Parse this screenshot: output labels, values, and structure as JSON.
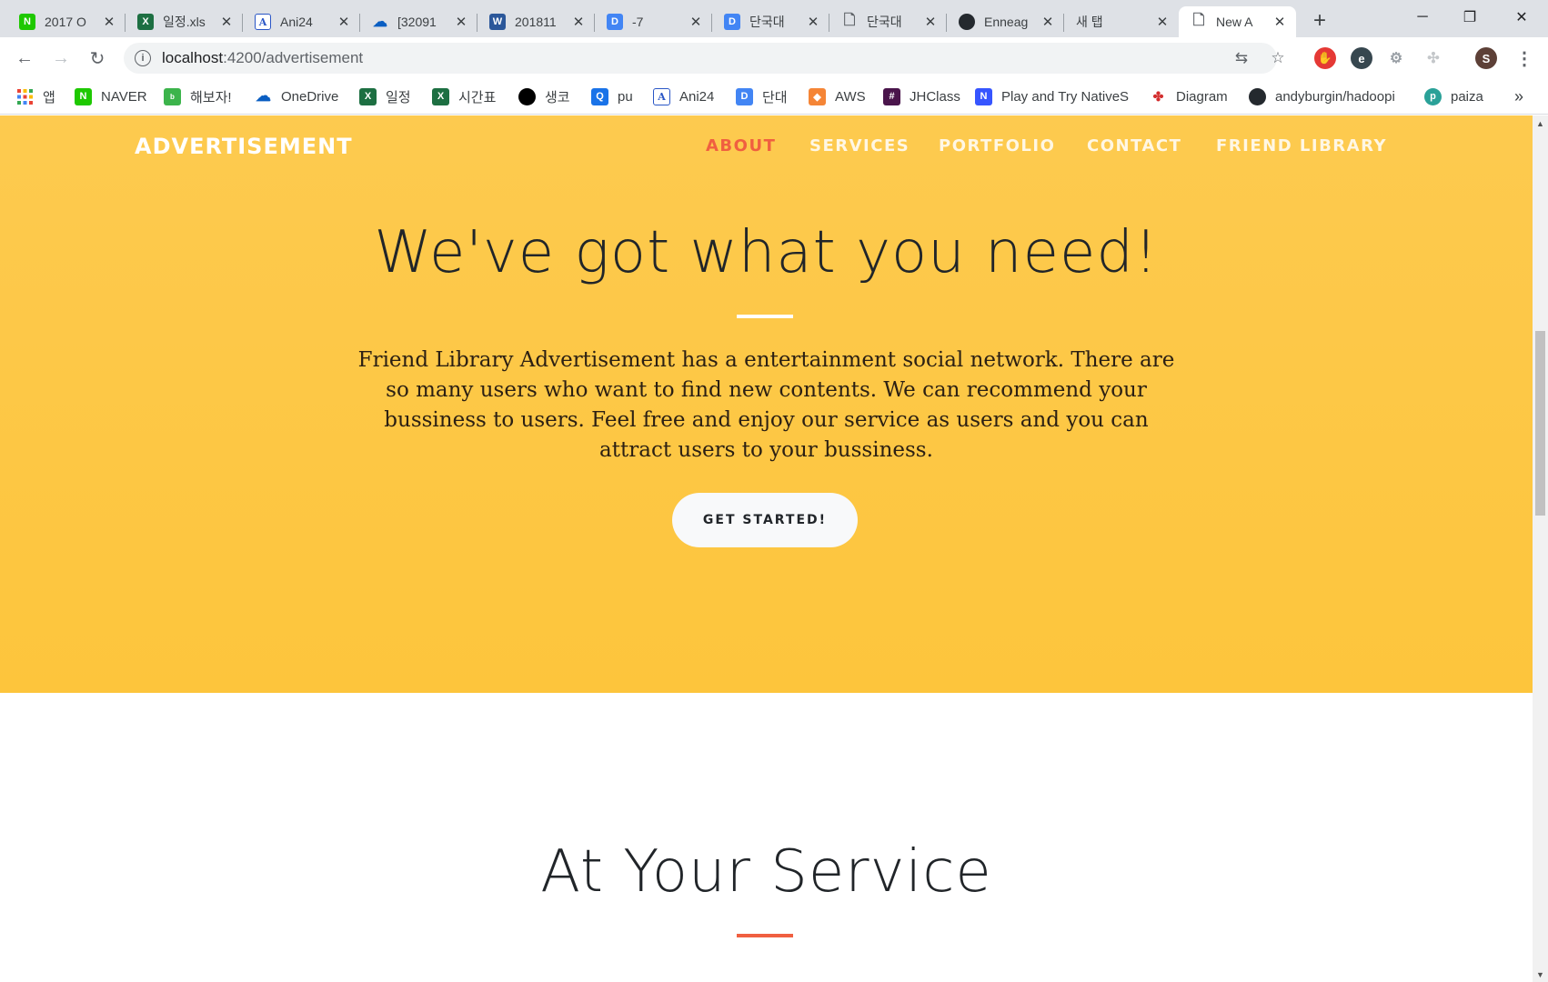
{
  "browser": {
    "tabs": [
      {
        "title": "2017 O",
        "favicon": "naver-icon",
        "favicon_color": "#1ec800",
        "favicon_text": "N"
      },
      {
        "title": "일정.xls",
        "favicon": "excel-icon",
        "favicon_color": "#1d6f42",
        "favicon_text": "X"
      },
      {
        "title": "Ani24",
        "favicon": "ani24-icon",
        "favicon_color": "#2a56c6",
        "favicon_text": "A"
      },
      {
        "title": "[32091",
        "favicon": "onedrive-icon",
        "favicon_color": "#0a5ec2",
        "favicon_text": "☁"
      },
      {
        "title": "201811",
        "favicon": "word-icon",
        "favicon_color": "#2b579a",
        "favicon_text": "W"
      },
      {
        "title": "-7",
        "favicon": "d-icon",
        "favicon_color": "#4285f4",
        "favicon_text": "D"
      },
      {
        "title": "단국대",
        "favicon": "d-icon",
        "favicon_color": "#4285f4",
        "favicon_text": "D"
      },
      {
        "title": "단국대",
        "favicon": "page-icon",
        "favicon_color": "#ffffff",
        "favicon_text": "🗋"
      },
      {
        "title": "Enneag",
        "favicon": "github-icon",
        "favicon_color": "#24292e",
        "favicon_text": "●"
      },
      {
        "title": "새 탭",
        "favicon": "",
        "favicon_color": "",
        "favicon_text": ""
      },
      {
        "title": "New A",
        "favicon": "page-icon",
        "favicon_color": "#ffffff",
        "favicon_text": "🗋",
        "active": true
      }
    ],
    "url_host": "localhost",
    "url_rest": ":4200/advertisement",
    "profile_initial": "S",
    "bookmarks": [
      {
        "label": "앱",
        "icon": "apps-grid-icon"
      },
      {
        "label": "NAVER",
        "icon": "naver-icon"
      },
      {
        "label": "해보자!",
        "icon": "blog-icon"
      },
      {
        "label": "OneDrive",
        "icon": "onedrive-icon"
      },
      {
        "label": "일정",
        "icon": "excel-icon"
      },
      {
        "label": "시간표",
        "icon": "excel-icon"
      },
      {
        "label": "생코",
        "icon": "circle-icon"
      },
      {
        "label": "pu",
        "icon": "q-icon"
      },
      {
        "label": "Ani24",
        "icon": "ani24-icon"
      },
      {
        "label": "단대",
        "icon": "d-icon"
      },
      {
        "label": "AWS",
        "icon": "aws-icon"
      },
      {
        "label": "JHClass",
        "icon": "hash-icon"
      },
      {
        "label": "Play and Try NativeS",
        "icon": "n-icon"
      },
      {
        "label": "Diagram",
        "icon": "diagram-icon"
      },
      {
        "label": "andyburgin/hadoopi",
        "icon": "github-icon"
      },
      {
        "label": "paiza",
        "icon": "paiza-icon"
      }
    ],
    "bookmarks_overflow": "»"
  },
  "site": {
    "brand": "ADVERTISEMENT",
    "nav": {
      "about": "ABOUT",
      "services": "SERVICES",
      "portfolio": "PORTFOLIO",
      "contact": "CONTACT",
      "friend_library": "FRIEND LIBRARY"
    },
    "hero": {
      "title": "We've got what you need!",
      "text": "Friend Library Advertisement has a entertainment social network. There are so many users who want to find new contents. We can recommend your bussiness to users. Feel free and enjoy our service as users and you can attract users to your bussiness.",
      "cta": "GET STARTED!"
    },
    "services": {
      "title": "At Your Service"
    }
  },
  "colors": {
    "hero_bg": "#fdc83f",
    "accent": "#f05f40"
  }
}
